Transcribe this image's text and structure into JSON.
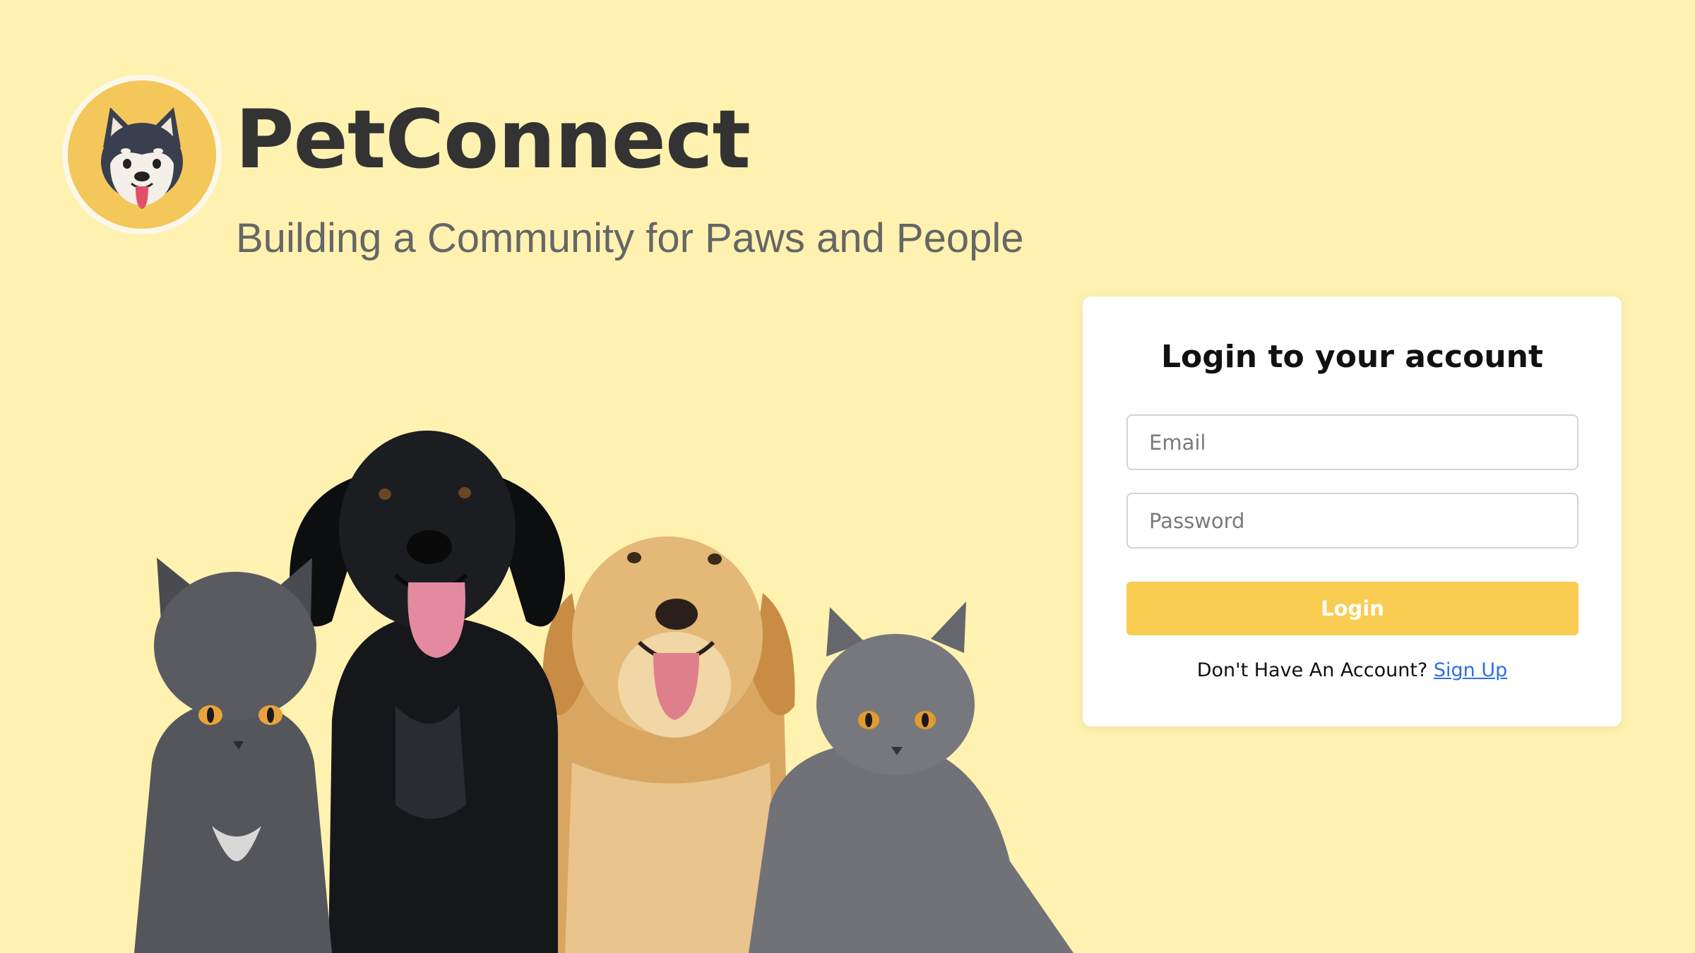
{
  "brand": {
    "title": "PetConnect",
    "tagline": "Building a Community for Paws and People",
    "logo_icon": "shiba-dog-face-icon"
  },
  "illustration": {
    "pets": [
      "gray-cat",
      "black-dog",
      "golden-retriever",
      "gray-cat"
    ]
  },
  "login": {
    "heading": "Login to your account",
    "email_placeholder": "Email",
    "email_value": "",
    "password_placeholder": "Password",
    "password_value": "",
    "button_label": "Login",
    "signup_prompt": "Don't Have An Account?",
    "signup_link": "Sign Up"
  },
  "colors": {
    "background": "#fff2b0",
    "accent": "#f9cd52",
    "link": "#2e6ee6",
    "title_text": "#333333"
  }
}
